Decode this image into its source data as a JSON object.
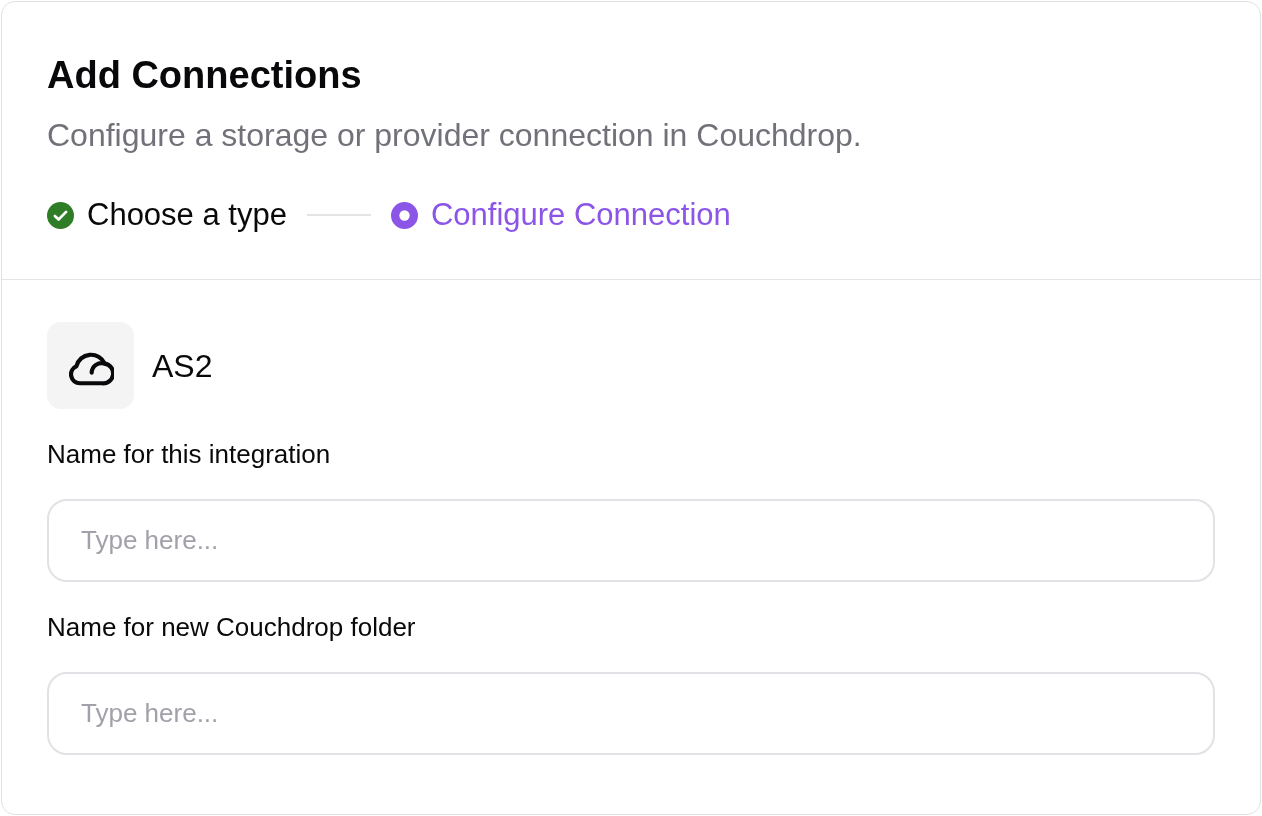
{
  "dialog": {
    "title": "Add Connections",
    "subtitle": "Configure a storage or provider connection in Couchdrop."
  },
  "steps": [
    {
      "label": "Choose a type",
      "completed": true,
      "selected": false
    },
    {
      "label": "Configure Connection",
      "completed": false,
      "selected": true
    }
  ],
  "connection": {
    "name": "AS2"
  },
  "fields": [
    {
      "label": "Name for this integration",
      "placeholder": "Type here..."
    },
    {
      "label": "Name for new Couchdrop folder",
      "placeholder": "Type here..."
    }
  ]
}
